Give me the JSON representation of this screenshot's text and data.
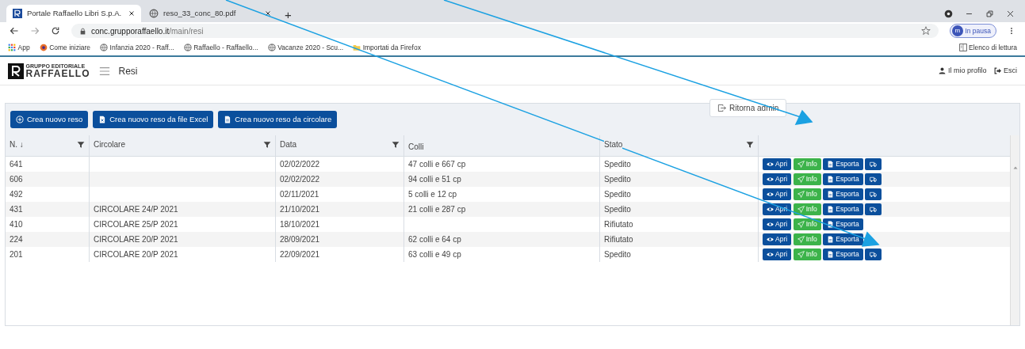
{
  "browser": {
    "tabs": [
      {
        "title": "Portale Raffaello Libri S.p.A.",
        "selected": true
      },
      {
        "title": "reso_33_conc_80.pdf",
        "selected": false
      }
    ],
    "new_tab": "+",
    "address": {
      "host": "conc.grupporaffaello.it",
      "path": "/main/resi"
    },
    "profile": {
      "initial": "m",
      "label": "In pausa"
    },
    "bookmarks": [
      {
        "kind": "apps",
        "label": "App"
      },
      {
        "kind": "browser",
        "label": "Come iniziare"
      },
      {
        "kind": "globe",
        "label": "Infanzia 2020 - Raff..."
      },
      {
        "kind": "globe",
        "label": "Raffaello - Raffaello..."
      },
      {
        "kind": "globe",
        "label": "Vacanze 2020 - Scu..."
      },
      {
        "kind": "folder",
        "label": "Importati da Firefox"
      }
    ],
    "reading_list": "Elenco di lettura"
  },
  "app": {
    "logo": {
      "line1": "GRUPPO EDITORIALE",
      "line2": "RAFFAELLO"
    },
    "page_title": "Resi",
    "user_links": [
      {
        "kind": "profile",
        "label": "Il mio profilo"
      },
      {
        "kind": "logout",
        "label": "Esci"
      }
    ]
  },
  "toolbar": {
    "buttons": [
      {
        "kind": "add",
        "label": "Crea nuovo reso"
      },
      {
        "kind": "excel",
        "label": "Crea nuovo reso da file Excel"
      },
      {
        "kind": "file",
        "label": "Crea nuovo reso da circolare"
      }
    ],
    "return_admin": "Ritorna admin"
  },
  "table": {
    "columns": [
      {
        "label": "N.",
        "sort_mark": "↓",
        "filter": true
      },
      {
        "label": "Circolare",
        "filter": true
      },
      {
        "label": "Data",
        "filter": true
      },
      {
        "label": "Colli",
        "filter": false
      },
      {
        "label": "Stato",
        "filter": true
      }
    ],
    "rows": [
      {
        "cells": [
          "641",
          "",
          "02/02/2022",
          "47 colli e 667 cp",
          "Spedito"
        ],
        "actions": [
          {
            "kind": "view",
            "label": "Apri"
          },
          {
            "kind": "send",
            "label": "Info"
          },
          {
            "kind": "export",
            "label": "Esporta"
          },
          {
            "kind": "ship"
          }
        ]
      },
      {
        "cells": [
          "606",
          "",
          "02/02/2022",
          "94 colli e 51 cp",
          "Spedito"
        ],
        "actions": [
          {
            "kind": "view",
            "label": "Apri"
          },
          {
            "kind": "send",
            "label": "Info"
          },
          {
            "kind": "export",
            "label": "Esporta"
          },
          {
            "kind": "ship"
          }
        ]
      },
      {
        "cells": [
          "492",
          "",
          "02/11/2021",
          "5 colli e 12 cp",
          "Spedito"
        ],
        "actions": [
          {
            "kind": "view",
            "label": "Apri"
          },
          {
            "kind": "send",
            "label": "Info"
          },
          {
            "kind": "export",
            "label": "Esporta"
          },
          {
            "kind": "ship"
          }
        ]
      },
      {
        "cells": [
          "431",
          "CIRCOLARE 24/P 2021",
          "21/10/2021",
          "21 colli e 287 cp",
          "Spedito"
        ],
        "actions": [
          {
            "kind": "view",
            "label": "Apri"
          },
          {
            "kind": "send",
            "label": "Info"
          },
          {
            "kind": "export",
            "label": "Esporta"
          },
          {
            "kind": "ship"
          }
        ]
      },
      {
        "cells": [
          "410",
          "CIRCOLARE 25/P 2021",
          "18/10/2021",
          "",
          "Rifiutato"
        ],
        "actions": [
          {
            "kind": "view",
            "label": "Apri"
          },
          {
            "kind": "send",
            "label": "Info"
          },
          {
            "kind": "export",
            "label": "Esporta"
          }
        ]
      },
      {
        "cells": [
          "224",
          "CIRCOLARE 20/P 2021",
          "28/09/2021",
          "62 colli e 64 cp",
          "Rifiutato"
        ],
        "actions": [
          {
            "kind": "view",
            "label": "Apri"
          },
          {
            "kind": "send",
            "label": "Info"
          },
          {
            "kind": "export",
            "label": "Esporta"
          }
        ]
      },
      {
        "cells": [
          "201",
          "CIRCOLARE 20/P 2021",
          "22/09/2021",
          "63 colli e 49 cp",
          "Spedito"
        ],
        "actions": [
          {
            "kind": "view",
            "label": "Apri"
          },
          {
            "kind": "send",
            "label": "Info"
          },
          {
            "kind": "export",
            "label": "Esporta"
          },
          {
            "kind": "ship"
          }
        ]
      }
    ]
  }
}
